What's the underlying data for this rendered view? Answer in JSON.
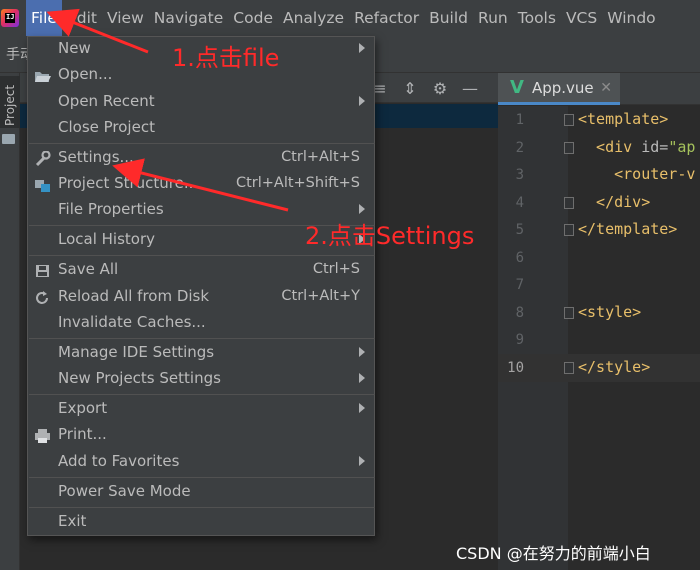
{
  "menubar": {
    "items": [
      "File",
      "Edit",
      "View",
      "Navigate",
      "Code",
      "Analyze",
      "Refactor",
      "Build",
      "Run",
      "Tools",
      "VCS",
      "Windo"
    ]
  },
  "toolbar": {
    "cjk_label": "手动"
  },
  "sidebar": {
    "project_tab": "Project"
  },
  "editor": {
    "tab_label": "App.vue",
    "line_numbers": [
      "1",
      "2",
      "3",
      "4",
      "5",
      "6",
      "7",
      "8",
      "9",
      "10"
    ],
    "lines": [
      {
        "tag": "<template>"
      },
      {
        "tag": "  <div ",
        "attr": "id=",
        "str": "\"ap"
      },
      {
        "tag": "    <router-v"
      },
      {
        "tag": "  </div>"
      },
      {
        "tag": "</template>"
      },
      {
        "tag": ""
      },
      {
        "tag": ""
      },
      {
        "tag": "<style>"
      },
      {
        "tag": ""
      },
      {
        "tag": "</style>"
      }
    ]
  },
  "file_menu": {
    "items": [
      {
        "label": "New",
        "shortcut": "",
        "submenu": true,
        "icon": ""
      },
      {
        "label": "Open...",
        "shortcut": "",
        "submenu": false,
        "icon": "folder-open-icon"
      },
      {
        "label": "Open Recent",
        "shortcut": "",
        "submenu": true,
        "icon": ""
      },
      {
        "label": "Close Project",
        "shortcut": "",
        "submenu": false,
        "icon": ""
      },
      {
        "label": "Settings...",
        "shortcut": "Ctrl+Alt+S",
        "submenu": false,
        "icon": "wrench-icon"
      },
      {
        "label": "Project Structure...",
        "shortcut": "Ctrl+Alt+Shift+S",
        "submenu": false,
        "icon": "project-structure-icon"
      },
      {
        "label": "File Properties",
        "shortcut": "",
        "submenu": true,
        "icon": ""
      },
      {
        "label": "Local History",
        "shortcut": "",
        "submenu": true,
        "icon": ""
      },
      {
        "label": "Save All",
        "shortcut": "Ctrl+S",
        "submenu": false,
        "icon": "save-icon"
      },
      {
        "label": "Reload All from Disk",
        "shortcut": "Ctrl+Alt+Y",
        "submenu": false,
        "icon": "reload-icon"
      },
      {
        "label": "Invalidate Caches...",
        "shortcut": "",
        "submenu": false,
        "icon": ""
      },
      {
        "label": "Manage IDE Settings",
        "shortcut": "",
        "submenu": true,
        "icon": ""
      },
      {
        "label": "New Projects Settings",
        "shortcut": "",
        "submenu": true,
        "icon": ""
      },
      {
        "label": "Export",
        "shortcut": "",
        "submenu": true,
        "icon": ""
      },
      {
        "label": "Print...",
        "shortcut": "",
        "submenu": false,
        "icon": "print-icon"
      },
      {
        "label": "Add to Favorites",
        "shortcut": "",
        "submenu": true,
        "icon": ""
      },
      {
        "label": "Power Save Mode",
        "shortcut": "",
        "submenu": false,
        "icon": ""
      },
      {
        "label": "Exit",
        "shortcut": "",
        "submenu": false,
        "icon": ""
      }
    ]
  },
  "annotations": {
    "step1": "1.点击file",
    "step2": "2.点击Settings"
  },
  "watermark": "CSDN @在努力的前端小白",
  "colors": {
    "annotation": "#ff2a2a",
    "menu_active": "#4b6eaf",
    "menu_bg": "#3c3f41",
    "editor_bg": "#2b2b2b"
  }
}
